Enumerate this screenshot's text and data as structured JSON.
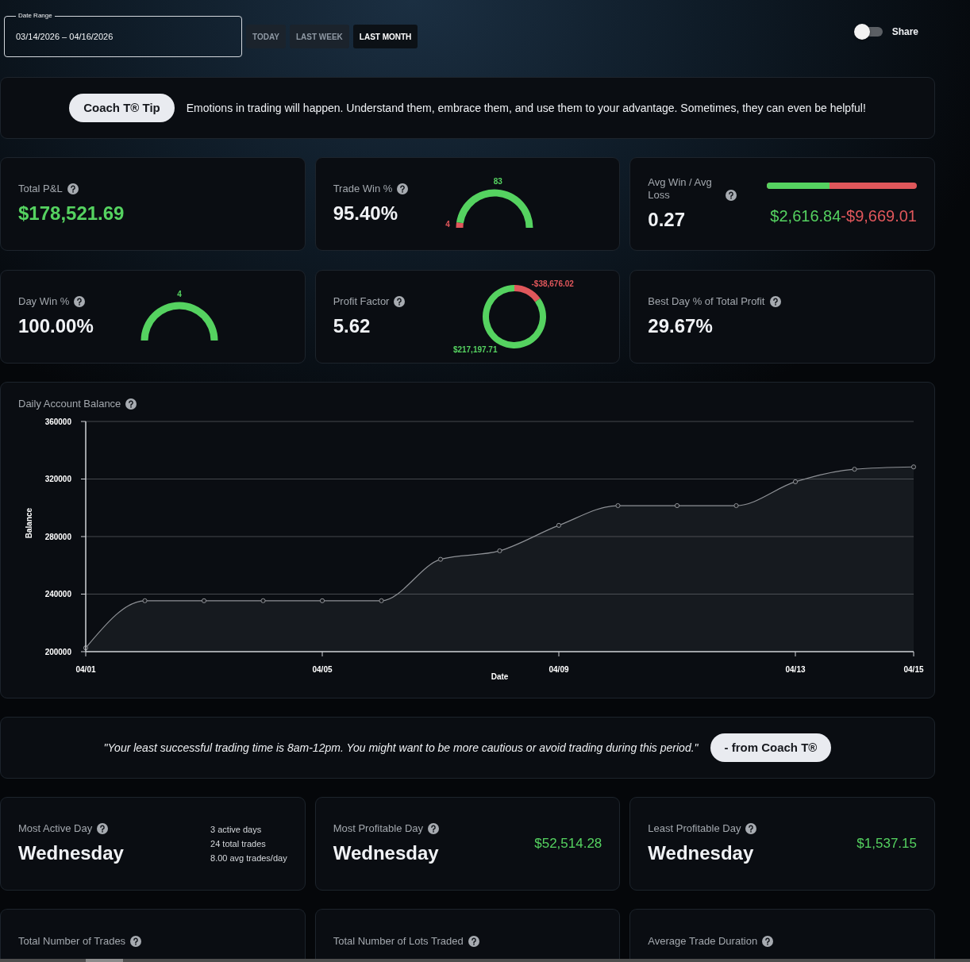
{
  "date_range": {
    "label": "Date Range",
    "value": "03/14/2026 – 04/16/2026"
  },
  "range_buttons": [
    {
      "label": "TODAY",
      "selected": false
    },
    {
      "label": "LAST WEEK",
      "selected": false
    },
    {
      "label": "LAST MONTH",
      "selected": true
    }
  ],
  "share": {
    "label": "Share",
    "on": false
  },
  "tip": {
    "badge": "Coach T® Tip",
    "text": "Emotions in trading will happen. Understand them, embrace them, and use them to your advantage. Sometimes, they can even be helpful!"
  },
  "stat_cards": [
    {
      "kind": "profit",
      "title": "Total P&L",
      "value": "$178,521.69"
    },
    {
      "kind": "gauge",
      "title": "Trade Win %",
      "value": "95.40%",
      "chart_data": {
        "type": "donut",
        "values": [
          4,
          83
        ],
        "value_labels": [
          "4",
          "83"
        ]
      }
    },
    {
      "kind": "ratio_bar",
      "title": "Avg Win / Avg Loss",
      "value": "0.27",
      "level": 0.42,
      "win": "$2,616.84",
      "loss": "-$9,669.01"
    },
    {
      "kind": "full_gauge",
      "title": "Day Win %",
      "value": "100.00%",
      "gauge_label": "4"
    },
    {
      "kind": "donut",
      "title": "Profit Factor",
      "value": "5.62",
      "chart_data": {
        "type": "donut",
        "values": [
          15.12,
          84.88
        ]
      },
      "slice_labels": [
        "-$38,676.02",
        "$217,197.71"
      ]
    },
    {
      "kind": "value",
      "title": "Best Day % of Total Profit",
      "value": "29.67%"
    }
  ],
  "balance_chart": {
    "title": "Daily Account Balance",
    "chart_data": {
      "type": "area",
      "xlabel": "Date",
      "ylabel": "Balance",
      "categories": [
        "04/01",
        null,
        null,
        null,
        "04/05",
        null,
        null,
        null,
        "04/09",
        null,
        null,
        null,
        "04/13",
        null,
        "04/15"
      ],
      "series": [
        {
          "color": "#8e9196",
          "values": [
            202600,
            235400,
            235400,
            235400,
            235400,
            235400,
            264200,
            270100,
            287800,
            301500,
            301500,
            301500,
            318100,
            326800,
            328400
          ]
        }
      ],
      "ylim": [
        200000,
        360000
      ],
      "yticks": [
        200000,
        240000,
        280000,
        320000,
        360000
      ],
      "grid": true
    }
  },
  "coach_quote": {
    "text": "\"Your least successful trading time is 8am-12pm. You might want to be more cautious or avoid trading during this period.\"",
    "badge": "- from Coach T®"
  },
  "day_cards": [
    {
      "kind": "stats",
      "title": "Most Active Day",
      "value": "Wednesday",
      "stats": [
        "3 active days",
        "24 total trades",
        "8.00 avg trades/day"
      ]
    },
    {
      "kind": "amount",
      "title": "Most Profitable Day",
      "value": "Wednesday",
      "amount": "$52,514.28"
    },
    {
      "kind": "amount",
      "title": "Least Profitable Day",
      "value": "Wednesday",
      "amount": "$1,537.15"
    }
  ],
  "count_cards": [
    {
      "title": "Total Number of Trades"
    },
    {
      "title": "Total Number of Lots Traded"
    },
    {
      "title": "Average Trade Duration"
    }
  ]
}
